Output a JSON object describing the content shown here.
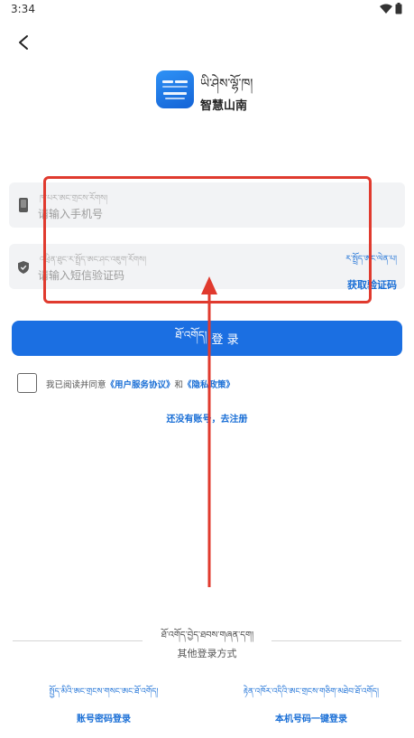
{
  "status_bar": {
    "time": "3:34",
    "wifi_icon": "wifi-icon",
    "battery_icon": "battery-icon"
  },
  "header": {
    "back_icon": "chevron-left-icon"
  },
  "app": {
    "logo_icon": "app-logo",
    "name_tibetan": "ཡི་ཤེས་ལྷོ་ཁ།",
    "name_chinese": "智慧山南"
  },
  "form": {
    "phone": {
      "icon": "phone-icon",
      "placeholder_tibetan": "ཁ་པར་ཨང་གྲངས་རོགས།",
      "placeholder": "请输入手机号",
      "value": ""
    },
    "sms": {
      "icon": "shield-icon",
      "placeholder_tibetan": "འཕྲིན་ཐུང་ར་སྤྲོད་ཨང་ཤང་འཇུག་རོགས།",
      "placeholder": "请输入短信验证码",
      "value": "",
      "get_code_tibetan": "ར་སྤྲོད་ཨང་ལེན་པ།",
      "get_code_label": "获取验证码"
    },
    "login_button": {
      "label_tibetan": "ཐོ་འགོད།",
      "label": "登 录"
    },
    "agreement": {
      "checked": false,
      "prefix": "我已阅读并同意",
      "terms_link": "《用户服务协议》",
      "conjunction": "和",
      "privacy_link": "《隐私政策》"
    },
    "register_link": "还没有账号，去注册"
  },
  "other_login": {
    "title_tibetan": "ཐོ་འགོད་བྱེད་ཐབས་གཞན་དག།",
    "title": "其他登录方式",
    "options": [
      {
        "label_tibetan": "སྤྱོད་མིའི་ཨང་གྲངས་གསང་ཨང་ཐོ་འགོད།",
        "label": "账号密码登录"
      },
      {
        "label_tibetan": "རྟེན་འཁོར་འདིའི་ཨང་གྲངས་གཅིག་མཐེབ་ཐོ་འགོད།",
        "label": "本机号码一键登录"
      }
    ]
  },
  "colors": {
    "accent": "#1a6fd6",
    "button": "#1b6fe2",
    "field_bg": "#f2f3f5",
    "annotation": "#e03a2e"
  }
}
